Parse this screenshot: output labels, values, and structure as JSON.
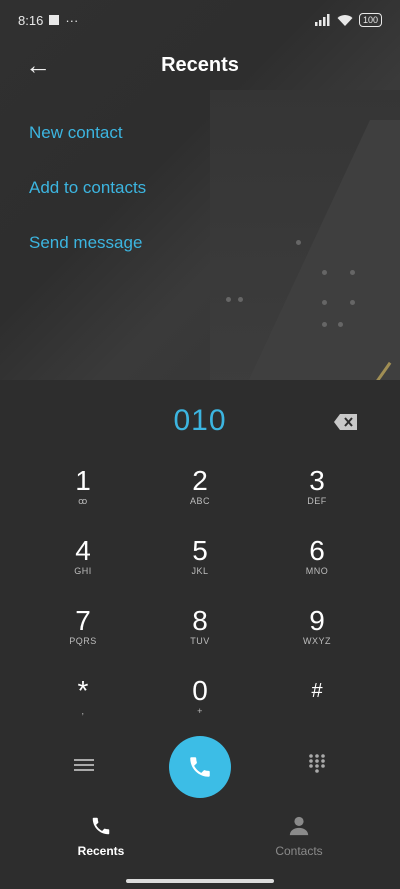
{
  "status_bar": {
    "time": "8:16",
    "extras": "···",
    "battery": "100"
  },
  "header": {
    "back_glyph": "←",
    "title": "Recents"
  },
  "menu": [
    {
      "label": "New contact"
    },
    {
      "label": "Add to contacts"
    },
    {
      "label": "Send message"
    }
  ],
  "dialer": {
    "number": "010",
    "keys": [
      {
        "digit": "1",
        "letters": "ꝏ"
      },
      {
        "digit": "2",
        "letters": "ABC"
      },
      {
        "digit": "3",
        "letters": "DEF"
      },
      {
        "digit": "4",
        "letters": "GHI"
      },
      {
        "digit": "5",
        "letters": "JKL"
      },
      {
        "digit": "6",
        "letters": "MNO"
      },
      {
        "digit": "7",
        "letters": "PQRS"
      },
      {
        "digit": "8",
        "letters": "TUV"
      },
      {
        "digit": "9",
        "letters": "WXYZ"
      },
      {
        "digit": "*",
        "letters": ","
      },
      {
        "digit": "0",
        "letters": "+"
      },
      {
        "digit": "#",
        "letters": ""
      }
    ]
  },
  "tabs": [
    {
      "label": "Recents",
      "active": true,
      "icon": "phone-icon"
    },
    {
      "label": "Contacts",
      "active": false,
      "icon": "person-icon"
    }
  ],
  "colors": {
    "accent": "#3cb5e0",
    "call_button": "#3cbde6",
    "background": "#2d2d2d"
  }
}
